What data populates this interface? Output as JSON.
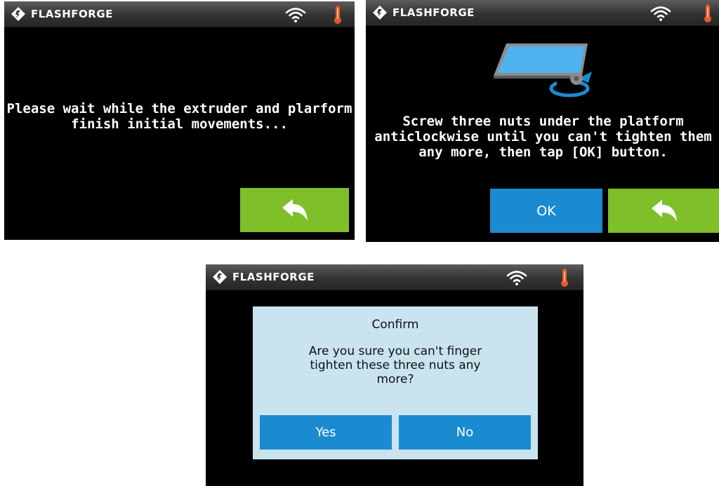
{
  "brand": "FLASHFORGE",
  "colors": {
    "status_bar": "#333333",
    "back_button": "#7ebf2a",
    "primary_button": "#1b8bd1",
    "dialog_bg": "#c9e3ef",
    "thermometer": "#e8582a"
  },
  "icons": [
    "flashforge-logo-icon",
    "wifi-icon",
    "thermometer-icon",
    "back-arrow-icon",
    "platform-adjust-icon"
  ],
  "screen1": {
    "message": "Please wait while the extruder and plarform\nfinish initial movements..."
  },
  "screen2": {
    "message": "Screw three nuts under the platform\nanticlockwise until you can't tighten them\nany more, then tap [OK] button.",
    "ok_label": "OK"
  },
  "screen3": {
    "dialog_title": "Confirm",
    "dialog_message": "Are you sure you can't finger\ntighten these three nuts any\nmore?",
    "yes_label": "Yes",
    "no_label": "No"
  }
}
